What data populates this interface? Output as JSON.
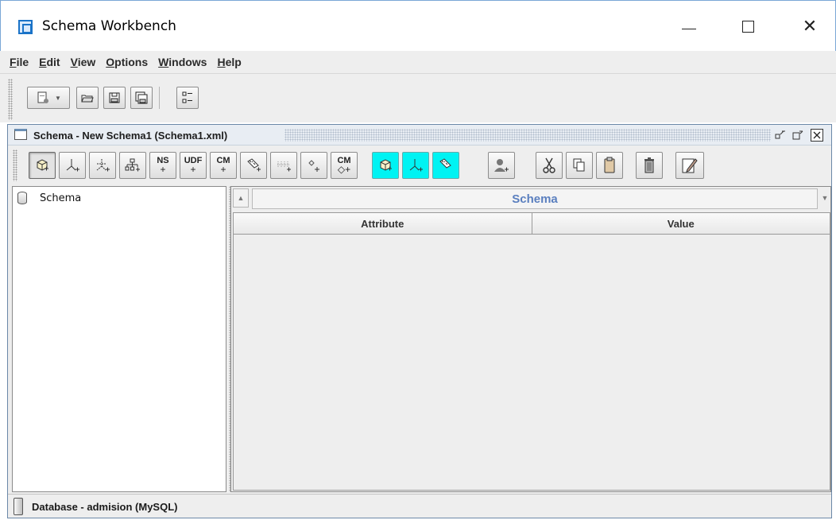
{
  "window": {
    "title": "Schema Workbench",
    "minimize": "",
    "maximize": "",
    "close": "✕"
  },
  "menu": {
    "items": [
      {
        "label": "File"
      },
      {
        "label": "Edit"
      },
      {
        "label": "View"
      },
      {
        "label": "Options"
      },
      {
        "label": "Windows"
      },
      {
        "label": "Help"
      }
    ]
  },
  "main_toolbar": {
    "icons": [
      "new-schema-icon",
      "dropdown-arrow-icon",
      "open-folder-icon",
      "save-icon",
      "save-as-icon",
      "preferences-icon"
    ]
  },
  "schema_frame": {
    "title": "Schema - New Schema1 (Schema1.xml)",
    "title_icon": "window-icon",
    "controls": [
      "restore-icon",
      "maximize-icon",
      "close-icon"
    ]
  },
  "schema_toolbar": {
    "buttons": [
      {
        "name": "add-cube-button",
        "text": "",
        "icon": "cube-add-icon"
      },
      {
        "name": "add-dimension-button",
        "text": "",
        "icon": "dimension-add-icon"
      },
      {
        "name": "add-dimension-usage-button",
        "text": "",
        "icon": "dimension-usage-add-icon"
      },
      {
        "name": "add-hierarchy-button",
        "text": "",
        "icon": "hierarchy-add-icon"
      },
      {
        "name": "add-named-set-button",
        "text": "NS",
        "icon": "named-set-add-icon"
      },
      {
        "name": "add-user-defined-function-button",
        "text": "UDF",
        "icon": "udf-add-icon"
      },
      {
        "name": "add-calculated-member-button",
        "text": "CM",
        "icon": "calculated-member-add-icon"
      },
      {
        "name": "add-measure-button",
        "text": "",
        "icon": "measure-add-icon"
      },
      {
        "name": "add-level-button",
        "text": "",
        "icon": "level-add-icon"
      },
      {
        "name": "add-property-button",
        "text": "",
        "icon": "property-add-icon"
      },
      {
        "name": "add-calculated-member-property-button",
        "text": "CM",
        "icon": "cm-property-add-icon"
      },
      {
        "name": "add-virtual-cube-button",
        "text": "",
        "icon": "virtual-cube-add-icon"
      },
      {
        "name": "add-virtual-dimension-button",
        "text": "",
        "icon": "virtual-dimension-add-icon"
      },
      {
        "name": "add-virtual-measure-button",
        "text": "",
        "icon": "virtual-measure-add-icon"
      },
      {
        "name": "add-role-button",
        "text": "",
        "icon": "role-add-icon"
      },
      {
        "name": "cut-button",
        "text": "",
        "icon": "scissors-icon"
      },
      {
        "name": "copy-button",
        "text": "",
        "icon": "copy-icon"
      },
      {
        "name": "paste-button",
        "text": "",
        "icon": "clipboard-icon"
      },
      {
        "name": "delete-button",
        "text": "",
        "icon": "trash-icon"
      },
      {
        "name": "edit-mode-button",
        "text": "",
        "icon": "edit-icon"
      }
    ]
  },
  "tree": {
    "root_label": "Schema",
    "root_icon": "database-icon"
  },
  "property_panel": {
    "section_title": "Schema",
    "columns": [
      "Attribute",
      "Value"
    ],
    "rows": []
  },
  "status": {
    "text": "Database - admision (MySQL)",
    "icon": "database-connection-icon"
  }
}
